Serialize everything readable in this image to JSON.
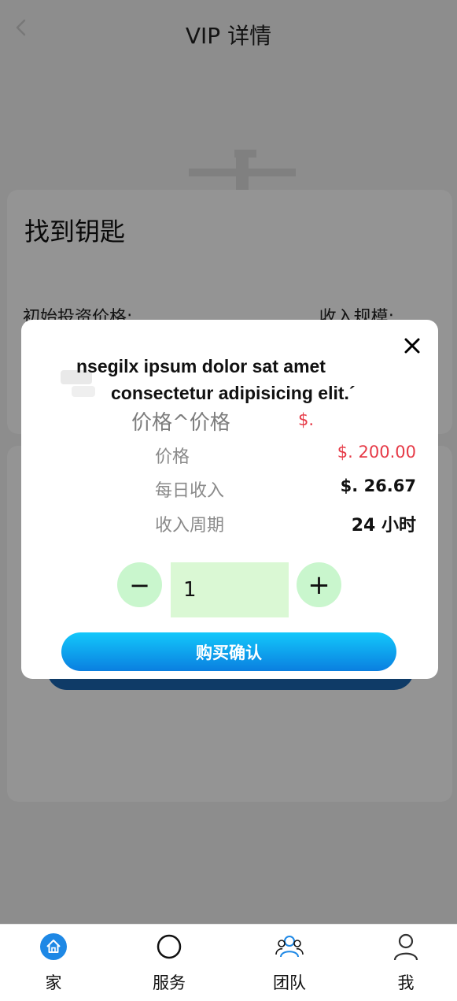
{
  "header": {
    "title": "VIP 详情"
  },
  "card": {
    "title": "找到钥匙",
    "initial_price_label": "初始投资价格:",
    "income_scale_label": "收入规模:"
  },
  "modal": {
    "text_line1": "nsegilx ipsum dolor sat amet",
    "text_line2": "consectetur adipisicing elit.´",
    "ghost_price_label": "价格^价格",
    "ghost_price_value": "$.",
    "rows": [
      {
        "label": "价格",
        "value": "$. 200.00"
      },
      {
        "label": "每日收入",
        "value": "$. 26.67"
      },
      {
        "label": "收入周期",
        "value": "24 小时"
      }
    ],
    "stepper": {
      "minus": "−",
      "plus": "+",
      "quantity": "1"
    },
    "confirm_label": "购买确认"
  },
  "tabbar": {
    "items": [
      {
        "label": "家",
        "icon": "home-icon",
        "active": true
      },
      {
        "label": "服务",
        "icon": "circle-icon"
      },
      {
        "label": "团队",
        "icon": "team-icon"
      },
      {
        "label": "我",
        "icon": "user-icon"
      }
    ]
  },
  "colors": {
    "accent": "#0a7fe0",
    "price_red": "#e63946",
    "stepper_green": "#c9f6cd",
    "overlay": "rgba(0,0,0,0.42)"
  }
}
